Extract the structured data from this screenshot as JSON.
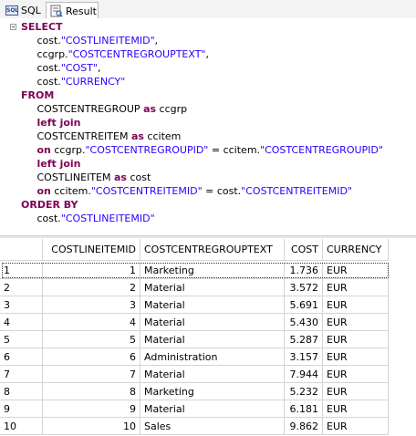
{
  "tabs": [
    {
      "label": "SQL",
      "icon": "sql-icon",
      "active": false
    },
    {
      "label": "Result",
      "icon": "result-table-icon",
      "active": true
    }
  ],
  "sql_lines": [
    [
      {
        "t": "SELECT",
        "c": "kw"
      }
    ],
    [
      {
        "t": "     cost."
      },
      {
        "t": "\"COSTLINEITEMID\"",
        "c": "str"
      },
      {
        "t": ","
      }
    ],
    [
      {
        "t": "     ccgrp."
      },
      {
        "t": "\"COSTCENTREGROUPTEXT\"",
        "c": "str"
      },
      {
        "t": ","
      }
    ],
    [
      {
        "t": "     cost."
      },
      {
        "t": "\"COST\"",
        "c": "str"
      },
      {
        "t": ","
      }
    ],
    [
      {
        "t": "     cost."
      },
      {
        "t": "\"CURRENCY\"",
        "c": "str"
      }
    ],
    [
      {
        "t": "FROM",
        "c": "kw"
      }
    ],
    [
      {
        "t": "     COSTCENTREGROUP "
      },
      {
        "t": "as",
        "c": "kw"
      },
      {
        "t": " ccgrp"
      }
    ],
    [
      {
        "t": "     "
      },
      {
        "t": "left join",
        "c": "kw"
      }
    ],
    [
      {
        "t": "     COSTCENTREITEM "
      },
      {
        "t": "as",
        "c": "kw"
      },
      {
        "t": " ccitem"
      }
    ],
    [
      {
        "t": "     "
      },
      {
        "t": "on",
        "c": "kw"
      },
      {
        "t": " ccgrp."
      },
      {
        "t": "\"COSTCENTREGROUPID\"",
        "c": "str"
      },
      {
        "t": " = ccitem."
      },
      {
        "t": "\"COSTCENTREGROUPID\"",
        "c": "str"
      }
    ],
    [
      {
        "t": "     "
      },
      {
        "t": "left join",
        "c": "kw"
      }
    ],
    [
      {
        "t": "     COSTLINEITEM "
      },
      {
        "t": "as",
        "c": "kw"
      },
      {
        "t": " cost"
      }
    ],
    [
      {
        "t": "     "
      },
      {
        "t": "on",
        "c": "kw"
      },
      {
        "t": " ccitem."
      },
      {
        "t": "\"COSTCENTREITEMID\"",
        "c": "str"
      },
      {
        "t": " = cost."
      },
      {
        "t": "\"COSTCENTREITEMID\"",
        "c": "str"
      }
    ],
    [
      {
        "t": "ORDER BY",
        "c": "kw"
      }
    ],
    [
      {
        "t": "     cost."
      },
      {
        "t": "\"COSTLINEITEMID\"",
        "c": "str"
      }
    ]
  ],
  "result": {
    "columns": [
      "",
      "COSTLINEITEMID",
      "COSTCENTREGROUPTEXT",
      "COST",
      "CURRENCY"
    ],
    "rows": [
      [
        "1",
        "1",
        "Marketing",
        "1.736",
        "EUR"
      ],
      [
        "2",
        "2",
        "Material",
        "3.572",
        "EUR"
      ],
      [
        "3",
        "3",
        "Material",
        "5.691",
        "EUR"
      ],
      [
        "4",
        "4",
        "Material",
        "5.430",
        "EUR"
      ],
      [
        "5",
        "5",
        "Material",
        "5.287",
        "EUR"
      ],
      [
        "6",
        "6",
        "Administration",
        "3.157",
        "EUR"
      ],
      [
        "7",
        "7",
        "Material",
        "7.944",
        "EUR"
      ],
      [
        "8",
        "8",
        "Marketing",
        "5.232",
        "EUR"
      ],
      [
        "9",
        "9",
        "Material",
        "6.181",
        "EUR"
      ],
      [
        "10",
        "10",
        "Sales",
        "9.862",
        "EUR"
      ]
    ],
    "selected_row": 0
  },
  "colors": {
    "keyword": "#7f0055",
    "string": "#2a00ff"
  }
}
